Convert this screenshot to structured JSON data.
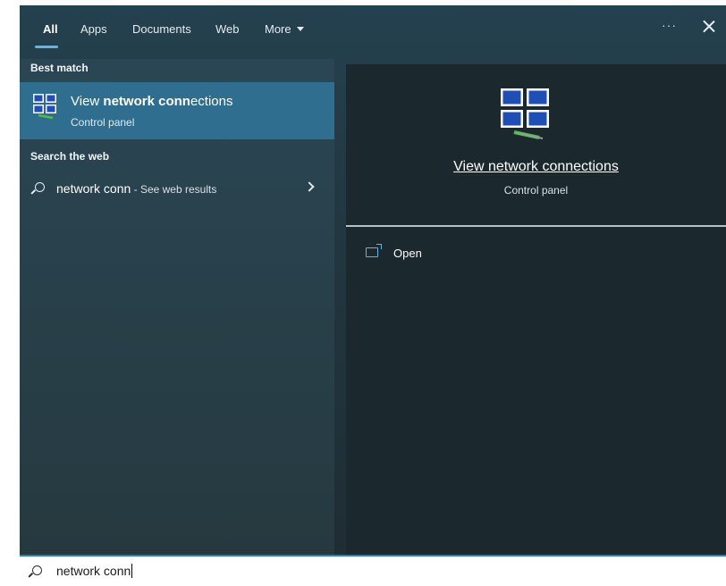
{
  "tabs": {
    "items": [
      {
        "label": "All",
        "active": true
      },
      {
        "label": "Apps",
        "active": false
      },
      {
        "label": "Documents",
        "active": false
      },
      {
        "label": "Web",
        "active": false
      },
      {
        "label": "More",
        "active": false
      }
    ],
    "more_menu_label": "···",
    "close_label": "Close"
  },
  "results": {
    "best_match_heading": "Best match",
    "best_match": {
      "title_prefix": "View ",
      "title_bold": "network conn",
      "title_suffix": "ections",
      "subtitle": "Control panel",
      "icon": "network-connections-icon"
    },
    "search_web_heading": "Search the web",
    "web_result": {
      "query": "network conn",
      "suffix": " - See web results",
      "icon": "search-icon"
    }
  },
  "details": {
    "title": "View network connections",
    "subtitle": "Control panel",
    "icon": "network-connections-icon",
    "actions": [
      {
        "label": "Open",
        "icon": "open-icon"
      }
    ]
  },
  "searchbox": {
    "value": "network conn",
    "icon": "search-icon"
  },
  "colors": {
    "accent": "#5fb4ea",
    "selected_row": "#2f6e8f",
    "detail_bg": "#1b282d",
    "searchbar_border": "#2e7fc0"
  }
}
